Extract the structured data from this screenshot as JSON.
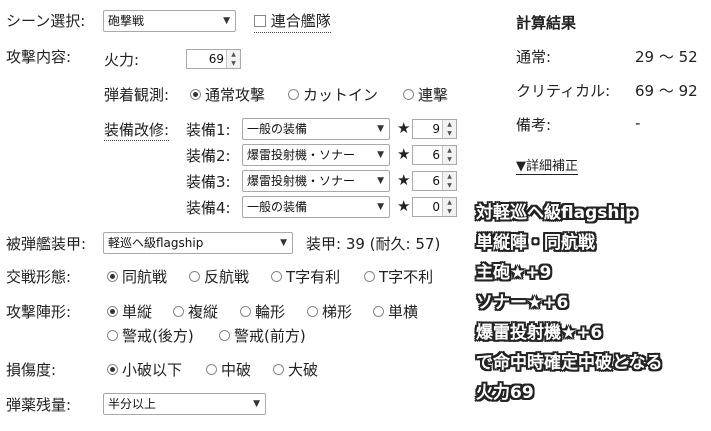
{
  "scene": {
    "label": "シーン選択:",
    "value": "砲撃戦",
    "combined_fleet_label": "連合艦隊"
  },
  "attack": {
    "label": "攻撃内容:",
    "firepower_label": "火力:",
    "firepower_value": "69",
    "spotting_label": "弾着観測:",
    "spotting_options": [
      "通常攻撃",
      "カットイン",
      "連撃"
    ],
    "improvement_label": "装備改修:",
    "equipment": [
      {
        "label": "装備1:",
        "value": "一般の装備",
        "star": "★",
        "level": "9"
      },
      {
        "label": "装備2:",
        "value": "爆雷投射機・ソナー",
        "star": "★",
        "level": "6"
      },
      {
        "label": "装備3:",
        "value": "爆雷投射機・ソナー",
        "star": "★",
        "level": "6"
      },
      {
        "label": "装備4:",
        "value": "一般の装備",
        "star": "★",
        "level": "0"
      }
    ]
  },
  "results": {
    "title": "計算結果",
    "normal_label": "通常:",
    "normal_value": "29 ～ 52",
    "critical_label": "クリティカル:",
    "critical_value": "69 ～ 92",
    "note_label": "備考:",
    "note_value": "-",
    "detail_link": "▼詳細補正"
  },
  "target": {
    "label": "被弾艦装甲:",
    "value": "軽巡ヘ級flagship",
    "armor_text": "装甲: 39 (耐久: 57)"
  },
  "engagement": {
    "label": "交戦形態:",
    "options": [
      "同航戦",
      "反航戦",
      "T字有利",
      "T字不利"
    ]
  },
  "formation": {
    "label": "攻撃陣形:",
    "options": [
      "単縦",
      "複縦",
      "輪形",
      "梯形",
      "単横",
      "警戒(後方)",
      "警戒(前方)"
    ]
  },
  "damage": {
    "label": "損傷度:",
    "options": [
      "小破以下",
      "中破",
      "大破"
    ]
  },
  "ammo": {
    "label": "弾薬残量:",
    "value": "半分以上"
  },
  "overlay": [
    "対軽巡ヘ級flagship",
    "単縦陣・同航戦",
    "主砲★+9",
    "ソナー★+6",
    "爆雷投射機★+6",
    "で命中時確定中破となる",
    "火力69"
  ],
  "colors": {
    "text": "#222222",
    "border": "#a9a9a9",
    "overlay_text": "#ffffff",
    "overlay_stroke": "#222222"
  },
  "icons": {
    "dropdown": "chevron-down-icon",
    "spinner": "spinner-arrows-icon"
  }
}
